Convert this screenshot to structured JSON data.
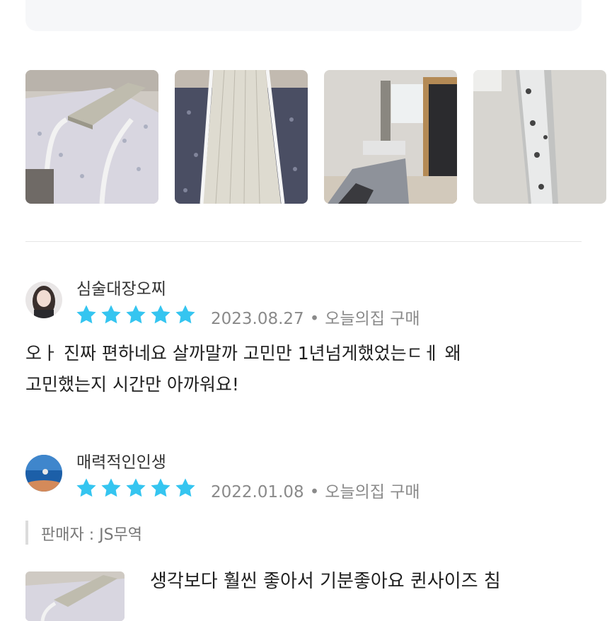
{
  "photos": [
    {
      "icon": "bed-with-overbed-table-photo"
    },
    {
      "icon": "overbed-table-top-view-photo"
    },
    {
      "icon": "room-with-bed-and-closet-photo"
    },
    {
      "icon": "wall-bracket-photo"
    }
  ],
  "reviews": [
    {
      "username": "심술대장오찌",
      "rating": 5,
      "date": "2023.08.27",
      "source": "오늘의집 구매",
      "lines": [
        "오ㅏ 진짜 편하네요 살까말까 고민만 1년넘게했었는ㄷㅔ 왜",
        "고민했는지 시간만 아까워요!"
      ]
    },
    {
      "username": "매력적인인생",
      "rating": 5,
      "date": "2022.01.08",
      "source": "오늘의집 구매",
      "seller": "판매자 : JS무역",
      "lines": [
        "생각보다 훨씬 좋아서 기분좋아요 퀸사이즈 침"
      ]
    }
  ],
  "colors": {
    "star": "#35c5f0",
    "meta": "#8a8a8a"
  }
}
